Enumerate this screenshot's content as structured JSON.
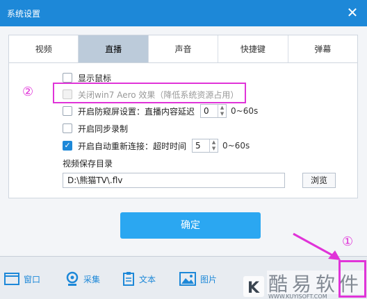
{
  "window": {
    "title": "系统设置",
    "close_glyph": "✕"
  },
  "tabs": [
    {
      "label": "视频",
      "active": false
    },
    {
      "label": "直播",
      "active": true
    },
    {
      "label": "声音",
      "active": false
    },
    {
      "label": "快捷键",
      "active": false
    },
    {
      "label": "弹幕",
      "active": false
    }
  ],
  "options": {
    "show_mouse": {
      "label": "显示鼠标",
      "checked": false
    },
    "close_aero": {
      "label": "关闭win7 Aero 效果（降低系统资源占用）",
      "checked": false,
      "disabled": true
    },
    "anti_peek": {
      "label": "开启防窥屏设置：直播内容延迟",
      "checked": false,
      "value": "0",
      "range": "0~60s"
    },
    "sync_record": {
      "label": "开启同步录制",
      "checked": false
    },
    "auto_reconnect": {
      "label": "开启自动重新连接：超时时间",
      "checked": true,
      "value": "5",
      "range": "0~60s"
    }
  },
  "save_dir": {
    "label": "视频保存目录",
    "value": "D:\\熊猫TV\\.flv",
    "browse_label": "浏览"
  },
  "confirm_label": "确定",
  "taskbar": [
    {
      "label": "窗口",
      "icon": "window-icon"
    },
    {
      "label": "采集",
      "icon": "camera-icon"
    },
    {
      "label": "文本",
      "icon": "text-icon"
    },
    {
      "label": "图片",
      "icon": "image-icon"
    }
  ],
  "annotations": {
    "marker_1": "①",
    "marker_2": "②"
  },
  "colors": {
    "accent": "#1d88d8",
    "button": "#2ba7f1",
    "annotation": "#e033d8"
  }
}
